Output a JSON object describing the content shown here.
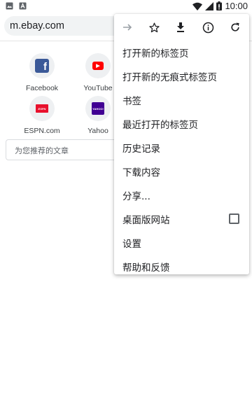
{
  "status_bar": {
    "time": "10:00",
    "icons": [
      "image-icon",
      "notification-a-icon",
      "wifi-icon",
      "signal-icon",
      "battery-icon"
    ]
  },
  "address_bar": {
    "url": "m.ebay.com"
  },
  "tiles": [
    {
      "label": "Facebook",
      "icon": "facebook-icon",
      "favicon_text": "f",
      "color": "#3b5998"
    },
    {
      "label": "YouTube",
      "icon": "youtube-icon",
      "favicon_text": "▶",
      "color": "#ff0000"
    },
    {
      "label": "ESPN.com",
      "icon": "espn-icon",
      "favicon_text": "ESPN",
      "color": "#e8112d"
    },
    {
      "label": "Yahoo",
      "icon": "yahoo-icon",
      "favicon_text": "YAHOO!",
      "color": "#410093"
    }
  ],
  "suggestions_label": "为您推荐的文章",
  "menu": {
    "icon_row": [
      "forward-icon",
      "bookmark-star-icon",
      "download-icon",
      "info-icon",
      "refresh-icon"
    ],
    "items": [
      {
        "label": "打开新的标签页"
      },
      {
        "label": "打开新的无痕式标签页"
      },
      {
        "label": "书签"
      },
      {
        "label": "最近打开的标签页"
      },
      {
        "label": "历史记录"
      },
      {
        "label": "下载内容"
      },
      {
        "label": "分享..."
      },
      {
        "label": "桌面版网站",
        "checkbox": true,
        "checked": false
      },
      {
        "label": "设置"
      },
      {
        "label": "帮助和反馈"
      }
    ]
  }
}
